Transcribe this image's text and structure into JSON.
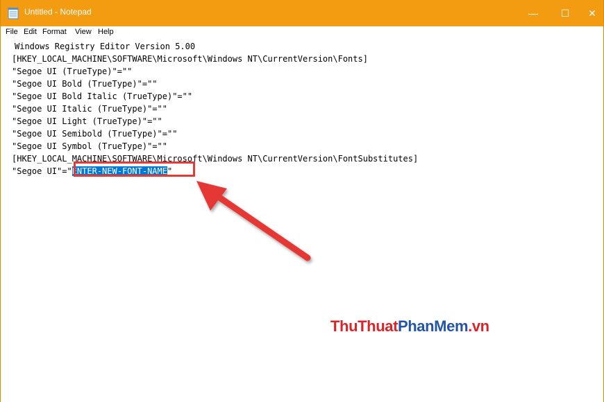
{
  "window": {
    "title": "Untitled - Notepad",
    "controls": {
      "minimize": "—",
      "maximize": "☐",
      "close": "✕"
    },
    "accent_color": "#f39c12"
  },
  "menu": [
    "File",
    "Edit",
    "Format",
    "View",
    "Help"
  ],
  "editor": {
    "lines": [
      "Windows Registry Editor Version 5.00",
      "[HKEY_LOCAL_MACHINE\\SOFTWARE\\Microsoft\\Windows NT\\CurrentVersion\\Fonts]",
      "\"Segoe UI (TrueType)\"=\"\"",
      "\"Segoe UI Bold (TrueType)\"=\"\"",
      "\"Segoe UI Bold Italic (TrueType)\"=\"\"",
      "\"Segoe UI Italic (TrueType)\"=\"\"",
      "\"Segoe UI Light (TrueType)\"=\"\"",
      "\"Segoe UI Semibold (TrueType)\"=\"\"",
      "\"Segoe UI Symbol (TrueType)\"=\"\"",
      "[HKEY_LOCAL_MACHINE\\SOFTWARE\\Microsoft\\Windows NT\\CurrentVersion\\FontSubstitutes]"
    ],
    "last_line": {
      "prefix": "\"Segoe UI\"=\"",
      "selected": "ENTER-NEW-FONT-NAME",
      "suffix": "\""
    },
    "selection_color": "#0078d7"
  },
  "annotation": {
    "highlight_color": "#e53935",
    "arrow_color": "#e53935"
  },
  "watermark": {
    "part1": "ThuThuat",
    "part2": "PhanMem",
    "part3": ".vn"
  }
}
